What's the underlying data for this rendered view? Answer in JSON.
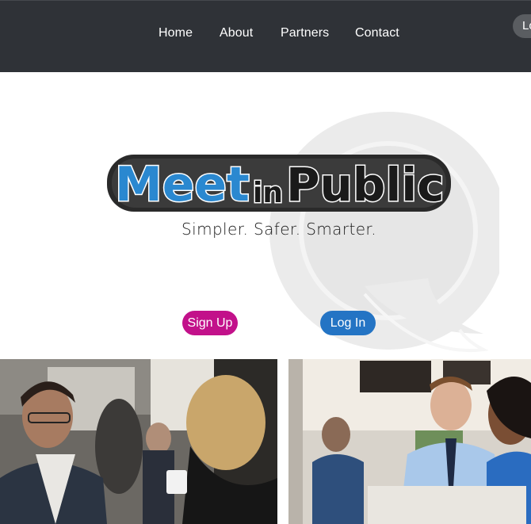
{
  "nav": {
    "links": [
      {
        "label": "Home"
      },
      {
        "label": "About"
      },
      {
        "label": "Partners"
      },
      {
        "label": "Contact"
      }
    ],
    "login_partial": "Lo"
  },
  "hero": {
    "logo": {
      "word_meet": "Meet",
      "word_in": "in",
      "word_public": "Public"
    },
    "tagline": "Simpler. Safer. Smarter.",
    "signup_label": "Sign Up",
    "login_label": "Log In"
  },
  "colors": {
    "navbar_bg": "#2f3237",
    "signup_bg": "#c2118a",
    "login_bg": "#2474c4",
    "logo_blue": "#2a88d0",
    "logo_dark": "#1a1a1a"
  },
  "photos": [
    {
      "name": "networking-photo"
    },
    {
      "name": "cafe-meeting-photo"
    }
  ]
}
